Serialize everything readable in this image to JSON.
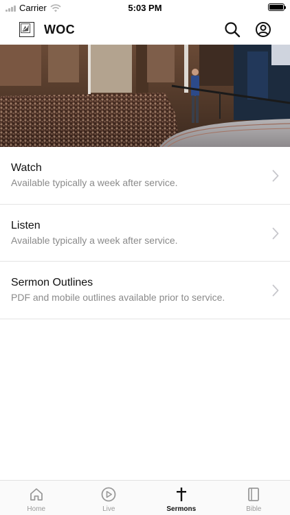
{
  "status_bar": {
    "carrier": "Carrier",
    "time": "5:03 PM"
  },
  "header": {
    "title": "WOC",
    "logo_icon": "woc-logo",
    "actions": [
      "search-icon",
      "account-icon"
    ]
  },
  "menu": {
    "items": [
      {
        "title": "Watch",
        "subtitle": "Available typically a week after service."
      },
      {
        "title": "Listen",
        "subtitle": "Available typically a week after service."
      },
      {
        "title": "Sermon Outlines",
        "subtitle": "PDF and mobile outlines available prior to service."
      }
    ]
  },
  "tabs": [
    {
      "label": "Home",
      "icon": "home-icon",
      "active": false
    },
    {
      "label": "Live",
      "icon": "play-circle-icon",
      "active": false
    },
    {
      "label": "Sermons",
      "icon": "cross-icon",
      "active": true
    },
    {
      "label": "Bible",
      "icon": "book-icon",
      "active": false
    }
  ],
  "colors": {
    "text_primary": "#111111",
    "text_secondary": "#8a8a8a",
    "tab_inactive": "#999999",
    "divider": "#e4e4e4"
  }
}
